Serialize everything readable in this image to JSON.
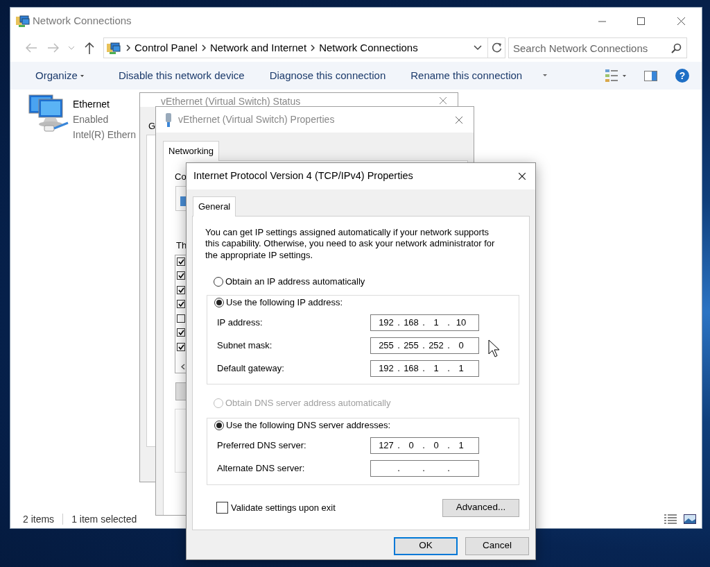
{
  "explorer": {
    "title": "Network Connections",
    "breadcrumbs": [
      "Control Panel",
      "Network and Internet",
      "Network Connections"
    ],
    "search": {
      "placeholder": "Search Network Connections"
    },
    "toolbar": [
      {
        "label": "Organize",
        "dropdown": true
      },
      {
        "label": "Disable this network device",
        "dropdown": false
      },
      {
        "label": "Diagnose this connection",
        "dropdown": false
      },
      {
        "label": "Rename this connection",
        "dropdown": false
      }
    ],
    "help": "?",
    "connections": [
      {
        "name": "Ethernet",
        "status": "Enabled",
        "device": "Intel(R) Ethern"
      }
    ],
    "status_bar": {
      "count": "2 items",
      "selection": "1 item selected"
    }
  },
  "status_window": {
    "title": "vEthernet (Virtual Switch) Status",
    "tab": "G"
  },
  "properties_window": {
    "title": "vEthernet (Virtual Switch) Properties",
    "tabs": [
      {
        "label": "Networking",
        "selected": true
      }
    ],
    "connect_label": "Co",
    "items_label": "Th",
    "items": [
      {
        "checked": true
      },
      {
        "checked": true
      },
      {
        "checked": true
      },
      {
        "checked": true
      },
      {
        "checked": false
      },
      {
        "checked": true
      },
      {
        "checked": true
      }
    ]
  },
  "ipv4_window": {
    "title": "Internet Protocol Version 4 (TCP/IPv4) Properties",
    "tabs": [
      {
        "label": "General",
        "selected": true
      }
    ],
    "intro": "You can get IP settings assigned automatically if your network supports this capability. Otherwise, you need to ask your network administrator for the appropriate IP settings.",
    "ip_options": [
      {
        "label": "Obtain an IP address automatically",
        "selected": false,
        "disabled": false
      },
      {
        "label": "Use the following IP address:",
        "selected": true,
        "disabled": false
      }
    ],
    "ip_fields": [
      {
        "label": "IP address:",
        "octets": [
          "192",
          "168",
          "1",
          "10"
        ],
        "dots": [
          ".",
          ".",
          "."
        ]
      },
      {
        "label": "Subnet mask:",
        "octets": [
          "255",
          "255",
          "252",
          "0"
        ],
        "dots": [
          ".",
          ".",
          "."
        ]
      },
      {
        "label": "Default gateway:",
        "octets": [
          "192",
          "168",
          "1",
          "1"
        ],
        "dots": [
          ".",
          ".",
          "."
        ]
      }
    ],
    "dns_options": [
      {
        "label": "Obtain DNS server address automatically",
        "selected": false,
        "disabled": true
      },
      {
        "label": "Use the following DNS server addresses:",
        "selected": true,
        "disabled": false
      }
    ],
    "dns_fields": [
      {
        "label": "Preferred DNS server:",
        "octets": [
          "127",
          "0",
          "0",
          "1"
        ],
        "dots": [
          ".",
          ".",
          "."
        ]
      },
      {
        "label": "Alternate DNS server:",
        "dots": [
          ".",
          ".",
          "."
        ]
      }
    ],
    "validate": {
      "label": "Validate settings upon exit",
      "checked": false
    },
    "advanced": "Advanced...",
    "buttons": [
      {
        "label": "OK",
        "default": true
      },
      {
        "label": "Cancel",
        "default": false
      }
    ]
  }
}
